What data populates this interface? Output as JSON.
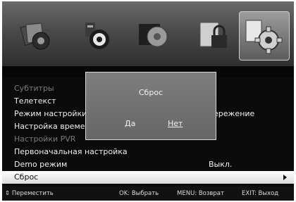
{
  "tabs": [
    {
      "name": "picture",
      "icon": "picture-icon"
    },
    {
      "name": "sound",
      "icon": "sound-icon"
    },
    {
      "name": "channel",
      "icon": "channel-icon"
    },
    {
      "name": "lock",
      "icon": "lock-icon"
    },
    {
      "name": "setup",
      "icon": "settings-gear-icon",
      "selected": true
    }
  ],
  "menu": {
    "items": [
      {
        "label": "Субтитры",
        "value": ""
      },
      {
        "label": "Телетекст",
        "value": ""
      },
      {
        "label": "Режим настройки",
        "value": "ережение"
      },
      {
        "label": "Настройка времени",
        "value": ""
      },
      {
        "label": "Настройки PVR",
        "value": ""
      },
      {
        "label": "Первоначальная настройка",
        "value": ""
      },
      {
        "label": "Demo режим",
        "value": "Выкл."
      },
      {
        "label": "Сброс",
        "value": ""
      }
    ],
    "selected_index": 7
  },
  "dialog": {
    "title": "Сброс",
    "yes_label": "Да",
    "no_label": "Нет"
  },
  "footer": {
    "move": "⇕ Переместить",
    "ok": "OK: Выбрать",
    "menu": "MENU: Возврат",
    "exit": "EXIT: Выход"
  }
}
